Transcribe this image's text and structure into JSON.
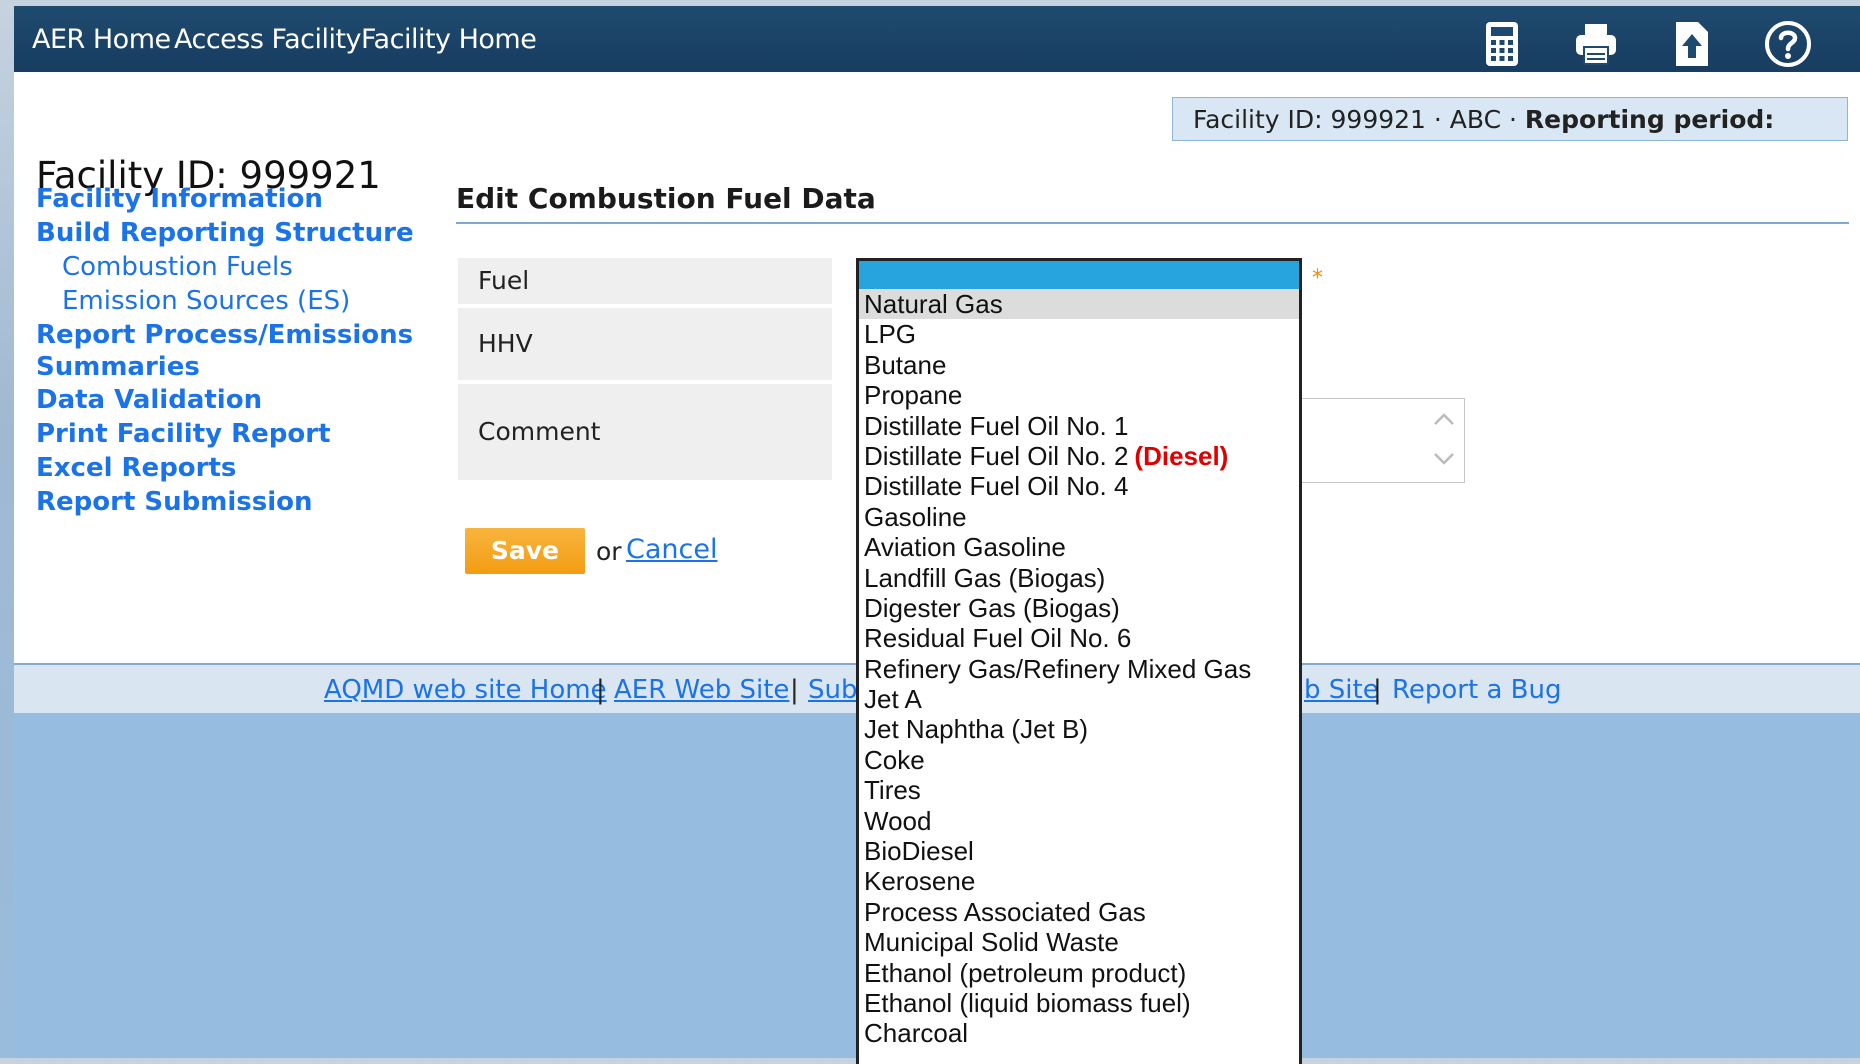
{
  "nav": {
    "links": [
      "AER Home",
      "Access Facility",
      "Facility Home"
    ],
    "icons": [
      "calculator-icon",
      "printer-icon",
      "upload-icon",
      "help-icon"
    ]
  },
  "facility_banner": {
    "text": "Facility ID: 999921 · ABC · ",
    "bold": "Reporting period:"
  },
  "sidebar": {
    "title": "Facility ID: 999921",
    "items": [
      {
        "label": "Facility Information"
      },
      {
        "label": "Build Reporting Structure"
      },
      {
        "label": "Combustion Fuels"
      },
      {
        "label": "Emission Sources (ES)"
      },
      {
        "label": "Report Process/Emissions"
      },
      {
        "label": "Summaries"
      },
      {
        "label": "Data Validation"
      },
      {
        "label": "Print Facility Report"
      },
      {
        "label": "Excel Reports"
      },
      {
        "label": "Report Submission"
      }
    ]
  },
  "form": {
    "heading": "Edit Combustion Fuel Data",
    "fuel_label": "Fuel",
    "hhv_label": "HHV",
    "comment_label": "Comment",
    "required_marker": "*",
    "save_label": "Save",
    "or_text": "or",
    "cancel_label": "Cancel"
  },
  "fuel_dropdown": {
    "selected": "",
    "options": [
      "Natural Gas",
      "LPG",
      "Butane",
      "Propane",
      "Distillate Fuel Oil No. 1",
      "Distillate Fuel Oil No. 2",
      "Distillate Fuel Oil No. 4",
      "Gasoline",
      "Aviation Gasoline",
      "Landfill Gas (Biogas)",
      "Digester Gas (Biogas)",
      "Residual Fuel Oil No. 6",
      "Refinery Gas/Refinery Mixed Gas",
      "Jet A",
      "Jet Naphtha (Jet B)",
      "Coke",
      "Tires",
      "Wood",
      "BioDiesel",
      "Kerosene",
      "Process Associated Gas",
      "Municipal Solid Waste",
      "Ethanol (petroleum product)",
      "Ethanol (liquid biomass fuel)",
      "Charcoal"
    ],
    "annotation": "(Diesel)"
  },
  "footer": {
    "links": [
      "AQMD web site Home",
      "AER Web Site",
      "Sub",
      "b Site",
      "Report a Bug"
    ],
    "separator": "|"
  }
}
